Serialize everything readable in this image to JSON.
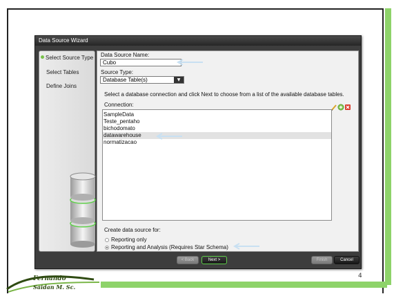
{
  "wizard": {
    "title": "Data Source Wizard",
    "steps": [
      {
        "label": "Select Source Type",
        "active": true
      },
      {
        "label": "Select Tables",
        "active": false
      },
      {
        "label": "Define Joins",
        "active": false
      }
    ],
    "name_label": "Data Source Name:",
    "name_value": "Cubo",
    "type_label": "Source Type:",
    "type_value": "Database Table(s)",
    "instruction": "Select a database connection and click Next to choose from a list of the available database tables.",
    "connection_label": "Connection:",
    "connections": [
      "SampleData",
      "Teste_pentaho",
      "bichodomato",
      "datawarehouse",
      "normatizacao"
    ],
    "selected_connection": "datawarehouse",
    "create_for_label": "Create data source for:",
    "options": [
      {
        "label": "Reporting only",
        "checked": false
      },
      {
        "label": "Reporting and Analysis (Requires Star Schema)",
        "checked": true
      }
    ],
    "buttons": {
      "back": "< Back",
      "next": "Next >",
      "finish": "Finish",
      "cancel": "Cancel"
    }
  },
  "slide": {
    "number": "4",
    "logo_line1": "Fernando",
    "logo_line2": "Saidan M. Sc."
  },
  "colors": {
    "accent_green": "#8ed36a",
    "dialog_dark": "#3d3d3d",
    "annotation_arrow": "#c8e0f2"
  }
}
